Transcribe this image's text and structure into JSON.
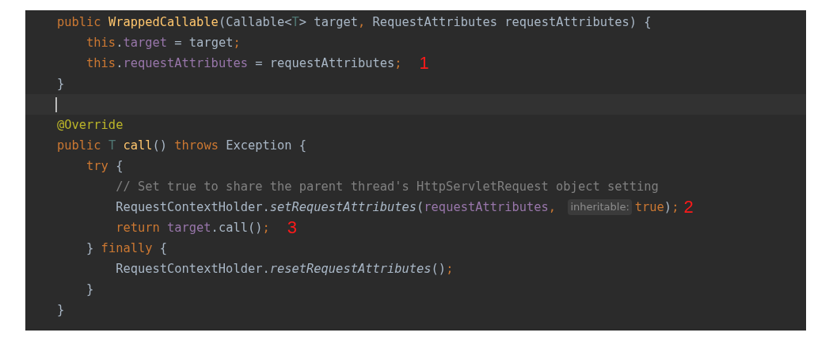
{
  "editor": {
    "lines": [
      {
        "current": false,
        "tokens": [
          {
            "kind": "keyword",
            "text": "public "
          },
          {
            "kind": "declaration",
            "text": "WrappedCallable"
          },
          {
            "kind": "plain",
            "text": "(Callable<"
          },
          {
            "kind": "type-param",
            "text": "T"
          },
          {
            "kind": "plain",
            "text": "> target"
          },
          {
            "kind": "keyword",
            "text": ", "
          },
          {
            "kind": "plain",
            "text": "RequestAttributes requestAttributes) {"
          }
        ]
      },
      {
        "current": false,
        "tokens": [
          {
            "kind": "keyword",
            "text": "    this"
          },
          {
            "kind": "plain",
            "text": "."
          },
          {
            "kind": "field",
            "text": "target"
          },
          {
            "kind": "plain",
            "text": " = target"
          },
          {
            "kind": "keyword",
            "text": ";"
          }
        ]
      },
      {
        "current": false,
        "tokens": [
          {
            "kind": "keyword",
            "text": "    this"
          },
          {
            "kind": "plain",
            "text": "."
          },
          {
            "kind": "field",
            "text": "requestAttributes"
          },
          {
            "kind": "plain",
            "text": " = requestAttributes"
          },
          {
            "kind": "keyword",
            "text": ";"
          },
          {
            "kind": "note",
            "text": "1"
          }
        ]
      },
      {
        "current": false,
        "tokens": [
          {
            "kind": "plain",
            "text": "}"
          }
        ]
      },
      {
        "current": true
      },
      {
        "current": false,
        "tokens": [
          {
            "kind": "annotation",
            "text": "@Override"
          }
        ]
      },
      {
        "current": false,
        "tokens": [
          {
            "kind": "keyword",
            "text": "public "
          },
          {
            "kind": "type-param",
            "text": "T "
          },
          {
            "kind": "declaration",
            "text": "call"
          },
          {
            "kind": "plain",
            "text": "() "
          },
          {
            "kind": "keyword",
            "text": "throws "
          },
          {
            "kind": "plain",
            "text": "Exception {"
          }
        ]
      },
      {
        "current": false,
        "tokens": [
          {
            "kind": "keyword",
            "text": "    try "
          },
          {
            "kind": "plain",
            "text": "{"
          }
        ]
      },
      {
        "current": false,
        "tokens": [
          {
            "kind": "comment",
            "text": "        // Set true to share the parent thread's HttpServletRequest object setting"
          }
        ]
      },
      {
        "current": false,
        "tokens": [
          {
            "kind": "plain",
            "text": "        RequestContextHolder."
          },
          {
            "kind": "static-call",
            "text": "setRequestAttributes"
          },
          {
            "kind": "plain",
            "text": "("
          },
          {
            "kind": "field",
            "text": "requestAttributes"
          },
          {
            "kind": "keyword",
            "text": ", "
          },
          {
            "kind": "hint",
            "text": "inheritable:"
          },
          {
            "kind": "keyword",
            "text": "true"
          },
          {
            "kind": "plain",
            "text": ")"
          },
          {
            "kind": "keyword",
            "text": ";"
          },
          {
            "kind": "note",
            "text": "2"
          }
        ]
      },
      {
        "current": false,
        "tokens": [
          {
            "kind": "keyword",
            "text": "        return "
          },
          {
            "kind": "field",
            "text": "target"
          },
          {
            "kind": "plain",
            "text": ".call()"
          },
          {
            "kind": "keyword",
            "text": ";"
          },
          {
            "kind": "note",
            "text": "3"
          }
        ]
      },
      {
        "current": false,
        "tokens": [
          {
            "kind": "plain",
            "text": "    } "
          },
          {
            "kind": "keyword",
            "text": "finally "
          },
          {
            "kind": "plain",
            "text": "{"
          }
        ]
      },
      {
        "current": false,
        "tokens": [
          {
            "kind": "plain",
            "text": "        RequestContextHolder."
          },
          {
            "kind": "static-call",
            "text": "resetRequestAttributes"
          },
          {
            "kind": "plain",
            "text": "()"
          },
          {
            "kind": "keyword",
            "text": ";"
          }
        ]
      },
      {
        "current": false,
        "tokens": [
          {
            "kind": "plain",
            "text": "    }"
          }
        ]
      },
      {
        "current": false,
        "tokens": [
          {
            "kind": "plain",
            "text": "}"
          }
        ]
      }
    ]
  }
}
